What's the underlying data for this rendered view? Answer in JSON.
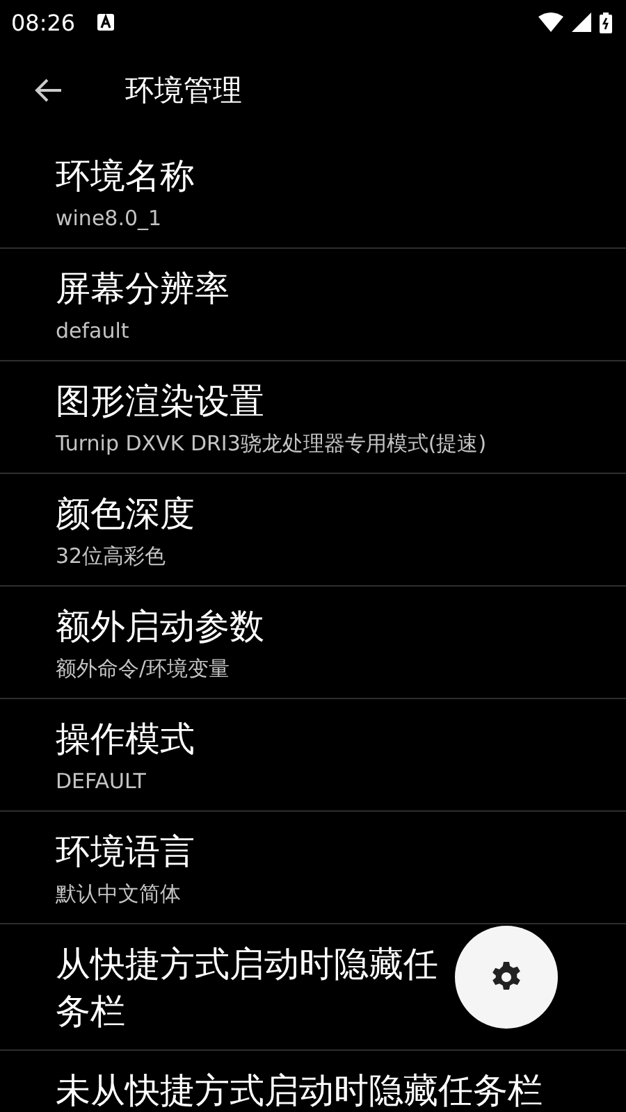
{
  "status_bar": {
    "time": "08:26"
  },
  "toolbar": {
    "title": "环境管理"
  },
  "items": [
    {
      "title": "环境名称",
      "summary": "wine8.0_1"
    },
    {
      "title": "屏幕分辨率",
      "summary": "default"
    },
    {
      "title": "图形渲染设置",
      "summary": "Turnip DXVK DRI3骁龙处理器专用模式(提速)"
    },
    {
      "title": "颜色深度",
      "summary": "32位高彩色"
    },
    {
      "title": "额外启动参数",
      "summary": "额外命令/环境变量"
    },
    {
      "title": "操作模式",
      "summary": "DEFAULT"
    },
    {
      "title": "环境语言",
      "summary": "默认中文简体"
    },
    {
      "title": "从快捷方式启动时隐藏任务栏"
    },
    {
      "title": "未从快捷方式启动时隐藏任务栏"
    }
  ]
}
